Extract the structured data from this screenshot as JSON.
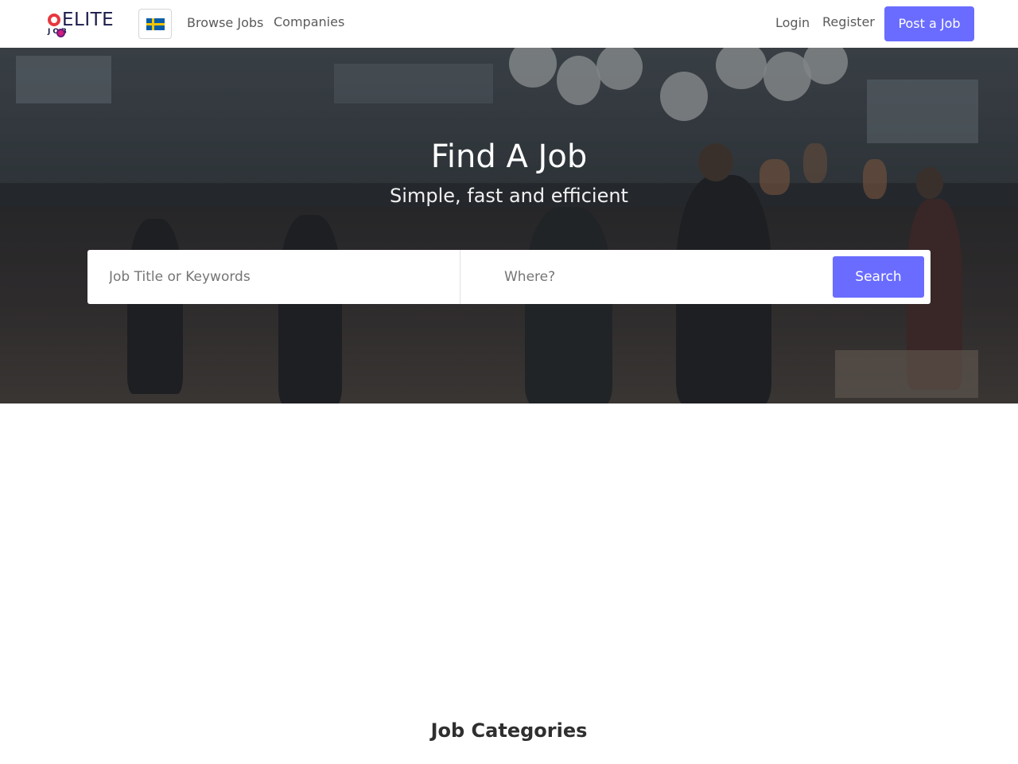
{
  "brand": {
    "name": "ELITE",
    "sub": "JOB"
  },
  "nav": {
    "language_flag": "sweden-flag-icon",
    "links": [
      "Browse Jobs",
      "Companies"
    ],
    "login": "Login",
    "register": "Register",
    "post_job": "Post a Job"
  },
  "hero": {
    "title": "Find A Job",
    "subtitle": "Simple, fast and efficient",
    "keywords_placeholder": "Job Title or Keywords",
    "location_placeholder": "Where?",
    "search_label": "Search"
  },
  "sections": {
    "categories_title": "Job Categories"
  },
  "colors": {
    "accent": "#6a6cff",
    "brand_dark": "#1b1b4b",
    "brand_red": "#e8373f"
  }
}
